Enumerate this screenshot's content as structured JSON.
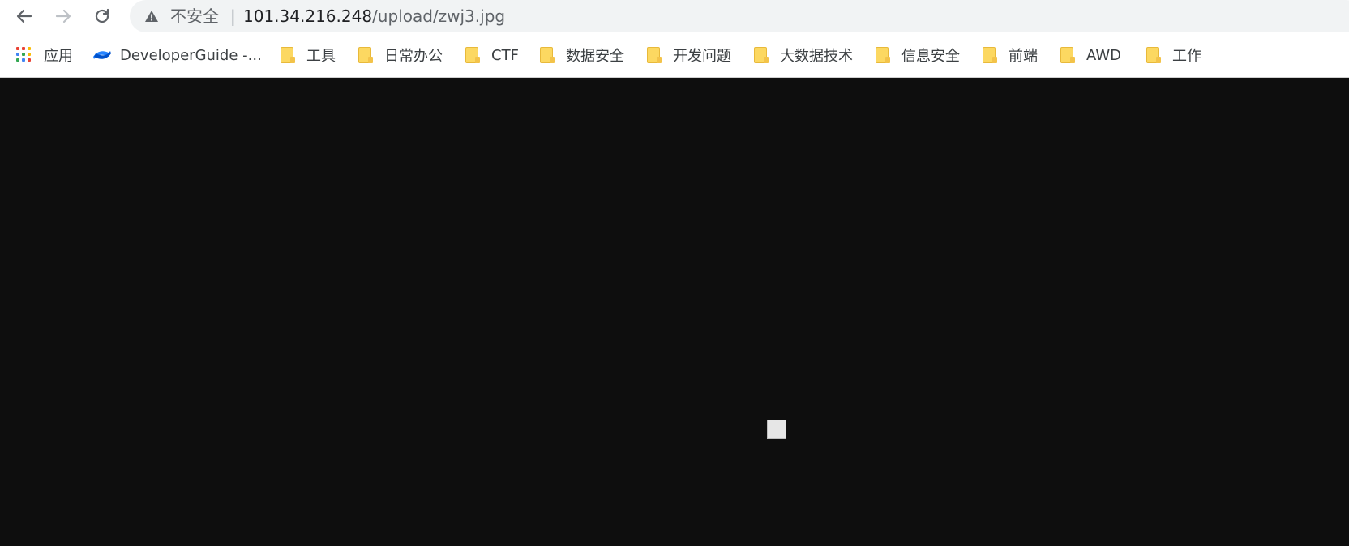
{
  "browser": {
    "back_icon": "arrow-left-icon",
    "forward_icon": "arrow-right-icon",
    "reload_icon": "reload-icon",
    "security_label": "不安全",
    "security_icon": "warning-triangle-icon",
    "separator": "|",
    "url_host": "101.34.216.248",
    "url_path": "/upload/zwj3.jpg"
  },
  "bookmarks": {
    "apps_label": "应用",
    "items": [
      {
        "label": "DeveloperGuide -...",
        "icon": "confluence-icon"
      },
      {
        "label": "工具",
        "icon": "folder-icon"
      },
      {
        "label": "日常办公",
        "icon": "folder-icon"
      },
      {
        "label": "CTF",
        "icon": "folder-icon"
      },
      {
        "label": "数据安全",
        "icon": "folder-icon"
      },
      {
        "label": "开发问题",
        "icon": "folder-icon"
      },
      {
        "label": "大数据技术",
        "icon": "folder-icon"
      },
      {
        "label": "信息安全",
        "icon": "folder-icon"
      },
      {
        "label": "前端",
        "icon": "folder-icon"
      },
      {
        "label": "AWD",
        "icon": "folder-icon"
      },
      {
        "label": "工作",
        "icon": "folder-icon"
      }
    ]
  },
  "content": {
    "background": "#0e0e0e",
    "image_state": "broken-image-placeholder"
  }
}
